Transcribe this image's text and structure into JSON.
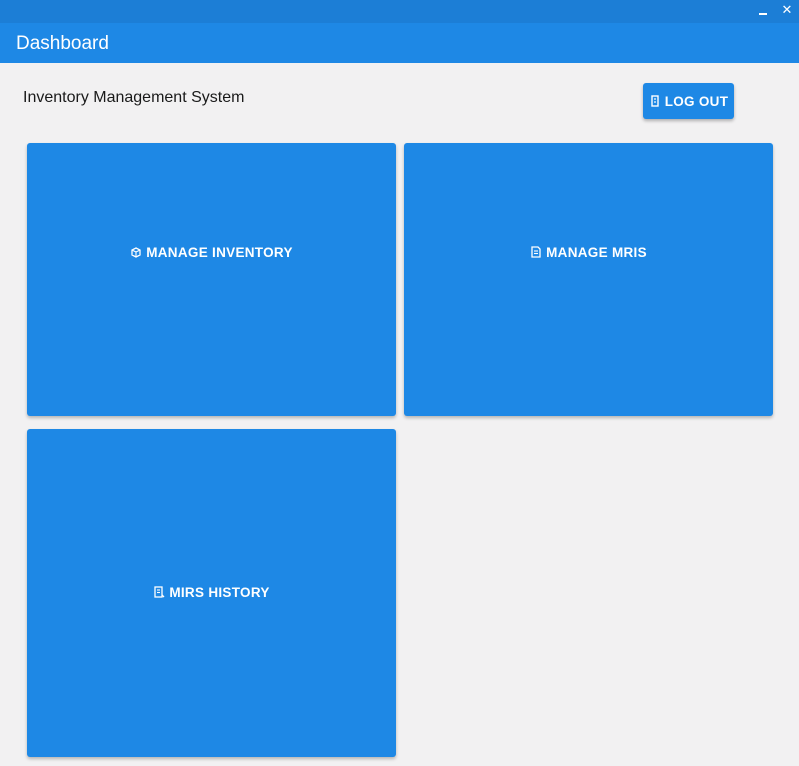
{
  "window": {
    "minimize_icon": "minimize-icon",
    "close_glyph": "✕"
  },
  "appbar": {
    "title": "Dashboard"
  },
  "header": {
    "subtitle": "Inventory Management System",
    "logout_label": "LOG OUT",
    "logout_icon": "logout-icon"
  },
  "tiles": [
    {
      "label": "MANAGE INVENTORY",
      "icon": "inventory-icon"
    },
    {
      "label": "MANAGE MRIS",
      "icon": "document-icon"
    },
    {
      "label": "MIRS HISTORY",
      "icon": "history-icon"
    }
  ],
  "colors": {
    "primary": "#1e88e5",
    "titlebar": "#1c7ed6",
    "background": "#f2f1f2",
    "text": "#1a1a1a"
  }
}
